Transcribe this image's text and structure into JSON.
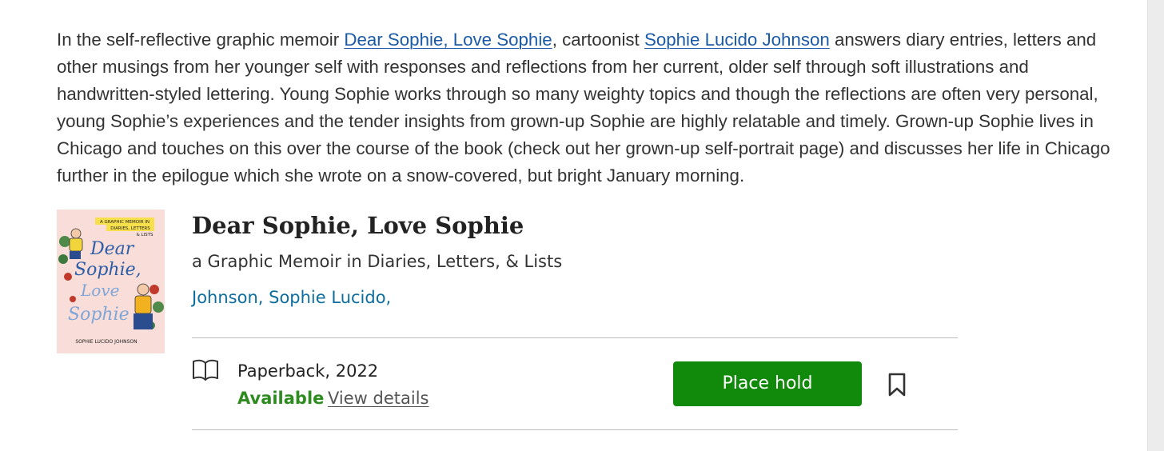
{
  "intro": {
    "before_link1": "In the self-reflective graphic memoir ",
    "link1": "Dear Sophie, Love Sophie",
    "between": ", cartoonist ",
    "link2": "Sophie Lucido Johnson",
    "after": " answers diary entries, letters and other musings from her younger self with responses and reflections from her current, older self through soft illustrations and handwritten-styled lettering. Young Sophie works through so many weighty topics and though the reflections are often very personal, young Sophie’s experiences and the tender insights from grown-up Sophie are highly relatable and timely. Grown-up Sophie lives in Chicago and touches on this over the course of the book (check out her grown-up self-portrait page) and discusses her life in Chicago further in the epilogue which she wrote on a snow-covered, but bright January morning."
  },
  "book": {
    "cover": {
      "banner_line1": "A GRAPHIC MEMOIR IN",
      "banner_line2": "DIARIES, LETTERS",
      "banner_line3": "& LISTS",
      "script_line1": "Dear",
      "script_line2": "Sophie,",
      "script_line3": "Love",
      "script_line4": "Sophie",
      "author": "SOPHIE LUCIDO JOHNSON"
    },
    "title": "Dear Sophie, Love Sophie",
    "subtitle": "a Graphic Memoir in Diaries, Letters, & Lists",
    "author": "Johnson, Sophie Lucido,"
  },
  "availability": {
    "format_icon": "book-open-icon",
    "format": "Paperback, 2022",
    "status": "Available",
    "details_link": "View details",
    "hold_button": "Place hold",
    "bookmark_icon": "bookmark-icon"
  },
  "colors": {
    "link": "#1a5aa6",
    "author": "#0d6d9e",
    "available": "#2e8b1f",
    "hold_button": "#118a0c"
  }
}
